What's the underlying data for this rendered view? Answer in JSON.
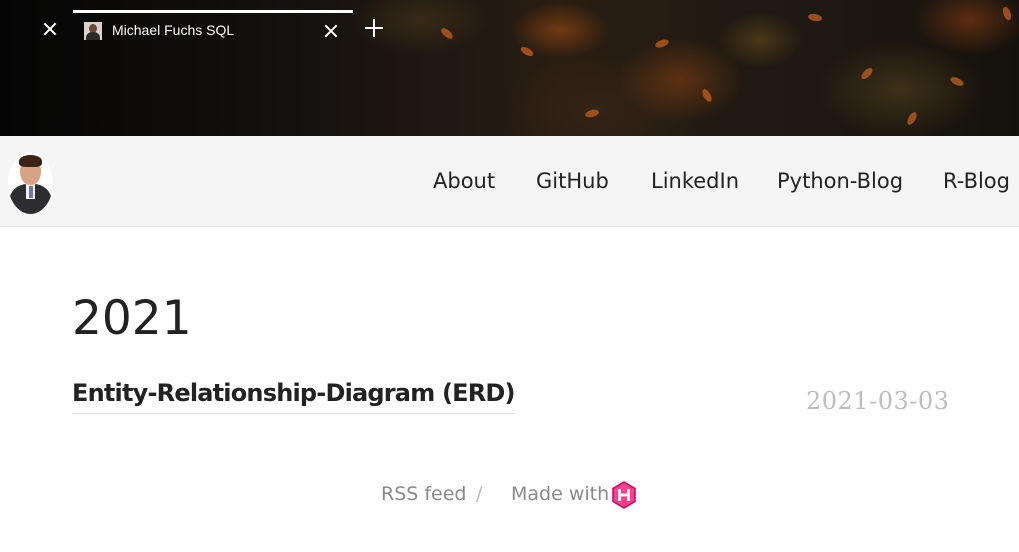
{
  "browser": {
    "tab": {
      "title": "Michael Fuchs SQL"
    },
    "icons": {
      "close": "close-icon",
      "new_tab": "plus-icon"
    }
  },
  "nav": {
    "links": [
      {
        "label": "About"
      },
      {
        "label": "GitHub"
      },
      {
        "label": "LinkedIn"
      },
      {
        "label": "Python-Blog"
      },
      {
        "label": "R-Blog"
      }
    ]
  },
  "archive": {
    "year": "2021",
    "posts": [
      {
        "title": "Entity-Relationship-Diagram (ERD)",
        "date": "2021-03-03"
      }
    ]
  },
  "footer": {
    "rss": "RSS feed",
    "separator": "/",
    "made_with": "Made with",
    "hugo_icon": "hugo-logo-icon",
    "hugo_color": "#ff4088"
  }
}
